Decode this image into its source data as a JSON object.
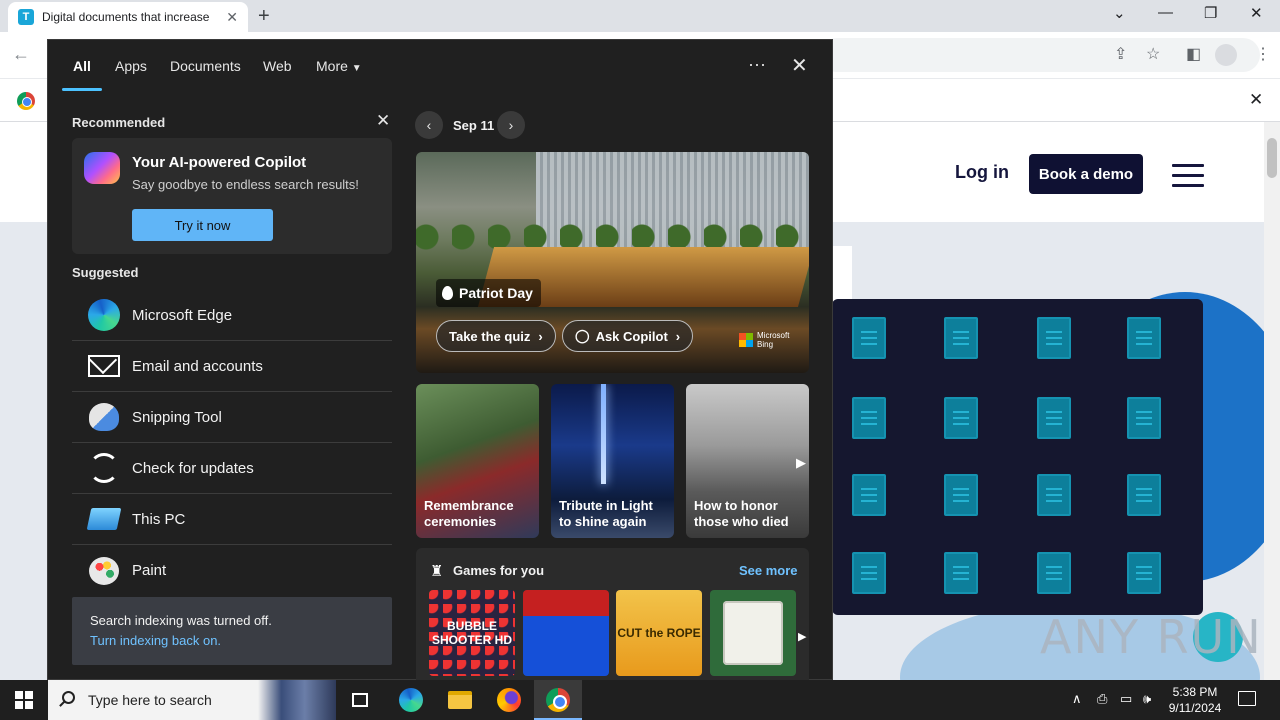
{
  "browser": {
    "tab_title": "Digital documents that increase",
    "tab_favicon_letter": "T"
  },
  "website": {
    "login": "Log in",
    "book_demo": "Book a demo"
  },
  "search_panel": {
    "tabs": [
      "All",
      "Apps",
      "Documents",
      "Web",
      "More"
    ],
    "recommended_label": "Recommended",
    "copilot": {
      "title": "Your AI-powered Copilot",
      "subtitle": "Say goodbye to endless search results!",
      "button": "Try it now"
    },
    "suggested_label": "Suggested",
    "suggested": [
      {
        "label": "Microsoft Edge",
        "icon": "edge-icon"
      },
      {
        "label": "Email and accounts",
        "icon": "mail-icon"
      },
      {
        "label": "Snipping Tool",
        "icon": "snipping-tool-icon"
      },
      {
        "label": "Check for updates",
        "icon": "update-icon"
      },
      {
        "label": "This PC",
        "icon": "this-pc-icon"
      },
      {
        "label": "Paint",
        "icon": "paint-icon"
      }
    ],
    "indexing": {
      "line1": "Search indexing was turned off.",
      "line2": "Turn indexing back on."
    },
    "date": "Sep 11",
    "hero": {
      "place": "Patriot Day",
      "quiz": "Take the quiz",
      "copilot": "Ask Copilot",
      "brand_line1": "Microsoft",
      "brand_line2": "Bing"
    },
    "tiles": [
      {
        "text": "Remembrance ceremonies"
      },
      {
        "text": "Tribute in Light to shine again"
      },
      {
        "text": "How to honor those who died"
      }
    ],
    "games": {
      "title": "Games for you",
      "see_more": "See more",
      "items": [
        {
          "label": "BUBBLE SHOOTER HD"
        },
        {
          "label": ""
        },
        {
          "label": "CUT the ROPE"
        },
        {
          "label": ""
        }
      ]
    }
  },
  "taskbar": {
    "search_placeholder": "Type here to search",
    "time": "5:38 PM",
    "date": "9/11/2024"
  },
  "watermark": "ANY RUN",
  "colors": {
    "accent": "#4cc2ff",
    "try_button": "#60b5f7",
    "link": "#6fc2ff",
    "demo_button": "#0f1133"
  }
}
